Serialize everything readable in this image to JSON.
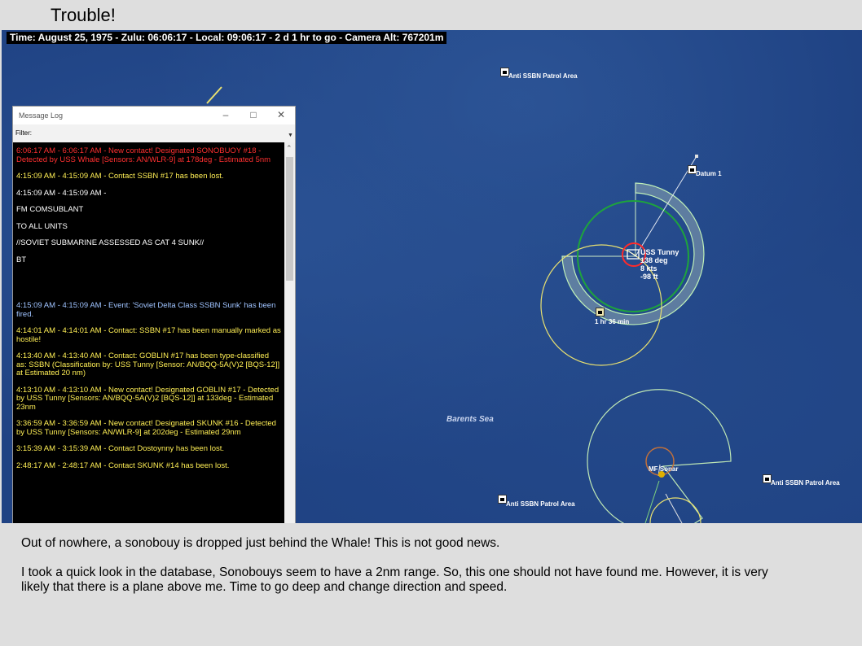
{
  "page": {
    "title": "Trouble!"
  },
  "status_bar": {
    "text": "Time: August 25, 1975 - Zulu: 06:06:17 - Local: 09:06:17 - 2 d 1 hr to go -  Camera Alt: 767201m"
  },
  "map": {
    "labels": {
      "patrol_top": "Anti SSBN Patrol Area",
      "datum": "Datum 1",
      "barents": "Barents Sea",
      "patrol_bottom_left": "Anti SSBN Patrol Area",
      "patrol_bottom_right": "Anti SSBN Patrol Area",
      "eta": "1 hr 36 min",
      "sonar": "MF Sonar"
    },
    "unit": {
      "name": "USS Tunny",
      "heading": "138 deg",
      "speed": "8 kts",
      "depth": "-98 ft"
    }
  },
  "message_log": {
    "title": "Message Log",
    "filter_label": "Filter:",
    "messages": [
      {
        "color": "red",
        "text": "6:06:17 AM - 6:06:17 AM - New contact! Designated SONOBUOY #18 - Detected by USS Whale [Sensors: AN/WLR-9] at 178deg - Estimated 5nm"
      },
      {
        "color": "yellow",
        "text": "4:15:09 AM - 4:15:09 AM - Contact SSBN #17 has been lost."
      },
      {
        "color": "white",
        "text": "4:15:09 AM - 4:15:09 AM -"
      },
      {
        "color": "white",
        "text": "FM COMSUBLANT"
      },
      {
        "color": "white",
        "text": "TO ALL UNITS"
      },
      {
        "color": "white",
        "text": "//SOVIET SUBMARINE ASSESSED AS CAT 4 SUNK//"
      },
      {
        "color": "white",
        "text": "BT"
      },
      {
        "color": "blue",
        "text": "4:15:09 AM - 4:15:09 AM - Event: 'Soviet Delta Class SSBN Sunk' has been fired."
      },
      {
        "color": "yellow",
        "text": "4:14:01 AM - 4:14:01 AM - Contact: SSBN #17 has been manually marked as hostile!"
      },
      {
        "color": "yellow",
        "text": "4:13:40 AM - 4:13:40 AM - Contact: GOBLIN #17 has been type-classified as: SSBN (Classification by: USS Tunny [Sensor: AN/BQQ-5A(V)2 [BQS-12]] at Estimated 20 nm)"
      },
      {
        "color": "yellow",
        "text": "4:13:10 AM - 4:13:10 AM - New contact! Designated GOBLIN #17 - Detected by USS Tunny [Sensors: AN/BQQ-5A(V)2 [BQS-12]] at 133deg - Estimated 23nm"
      },
      {
        "color": "yellow",
        "text": "3:36:59 AM - 3:36:59 AM - New contact! Designated SKUNK #16 - Detected by USS Tunny [Sensors: AN/WLR-9] at 202deg - Estimated 29nm"
      },
      {
        "color": "yellow",
        "text": "3:15:39 AM - 3:15:39 AM - Contact Dostoynny has been lost."
      },
      {
        "color": "yellow",
        "text": "2:48:17 AM - 2:48:17 AM - Contact SKUNK #14 has been lost."
      }
    ]
  },
  "caption": {
    "p1": "Out of nowhere, a sonobouy is dropped just behind the Whale!  This is not good news.",
    "p2": "I took a quick look in the database, Sonobouys seem to have a 2nm range.  So, this one should not have found me.  However, it is very likely that there is a plane above me.  Time to go deep and change direction and speed."
  }
}
